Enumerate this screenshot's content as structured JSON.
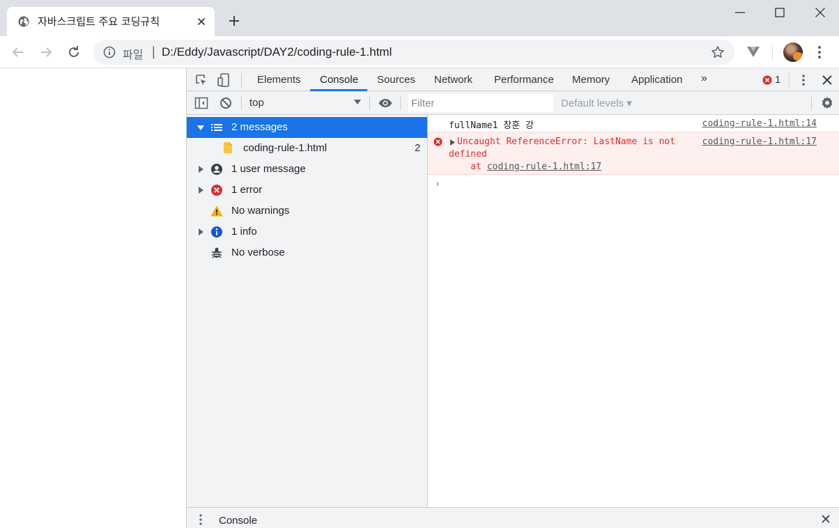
{
  "browser": {
    "tab_title": "자바스크립트 주요 코딩규칙",
    "url_scheme_label": "파일",
    "url": "D:/Eddy/Javascript/DAY2/coding-rule-1.html",
    "icons": [
      "globe-icon",
      "close-icon",
      "plus-icon",
      "minimize-icon",
      "maximize-icon",
      "window-close-icon",
      "back-icon",
      "forward-icon",
      "reload-icon",
      "info-icon",
      "star-icon",
      "extension-icon",
      "avatar",
      "menu-dots-icon"
    ]
  },
  "devtools": {
    "tabs": [
      {
        "label": "Elements"
      },
      {
        "label": "Console"
      },
      {
        "label": "Sources"
      },
      {
        "label": "Network"
      },
      {
        "label": "Performance"
      },
      {
        "label": "Memory"
      },
      {
        "label": "Application"
      }
    ],
    "more_tabs_label": "»",
    "active_tab": "Console",
    "error_count": "1",
    "context": "top",
    "filter_placeholder": "Filter",
    "levels_label": "Default levels ▾",
    "sidebar": [
      {
        "label": "2 messages",
        "selected": true,
        "icon": "list-icon"
      },
      {
        "label": "coding-rule-1.html",
        "count": "2",
        "icon": "file-icon"
      },
      {
        "label": "1 user message",
        "icon": "user-icon"
      },
      {
        "label": "1 error",
        "icon": "error-icon"
      },
      {
        "label": "No warnings",
        "icon": "warning-icon"
      },
      {
        "label": "1 info",
        "icon": "info-icon"
      },
      {
        "label": "No verbose",
        "icon": "bug-icon"
      }
    ],
    "messages": [
      {
        "text": "fullName1 창훈 강",
        "link": "coding-rule-1.html:14",
        "type": "log"
      },
      {
        "line1": "Uncaught ReferenceError: LastName is not",
        "line2": "defined",
        "line3_prefix": "    at ",
        "line3_link": "coding-rule-1.html:17",
        "link": "coding-rule-1.html:17",
        "type": "error"
      }
    ],
    "prompt": "›",
    "drawer_title": "Console",
    "colors": {
      "accent": "#1a73e8",
      "error": "#e22b2b",
      "error_bg": "#fff0f0"
    }
  }
}
